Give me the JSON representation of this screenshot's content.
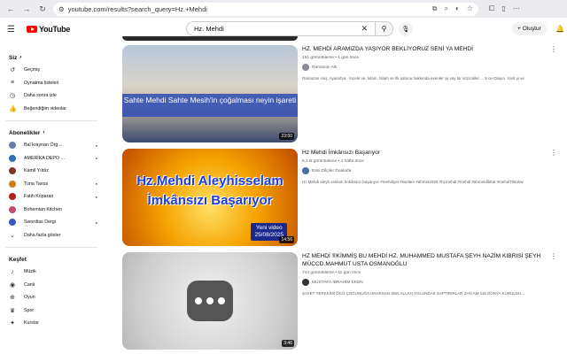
{
  "browser": {
    "url": "youtube.com/results?search_query=Hz.+Mehdi"
  },
  "header": {
    "logo_text": "YouTube",
    "search_value": "Hz. Mehdi",
    "create_label": "Oluştur"
  },
  "sidebar": {
    "you_heading": "Siz",
    "you_items": [
      {
        "label": "Geçmiş",
        "icon": "history-icon"
      },
      {
        "label": "Oynatma listeleri",
        "icon": "playlist-icon"
      },
      {
        "label": "Daha sonra izle",
        "icon": "clock-icon"
      },
      {
        "label": "Beğendiğim videolar",
        "icon": "thumbs-up-icon"
      }
    ],
    "subs_heading": "Abonelikler",
    "subscriptions": [
      {
        "label": "Bal kraynan Örg...",
        "color": "#6b7fa3"
      },
      {
        "label": "AMERİKA DEPO ...",
        "color": "#2f6fba"
      },
      {
        "label": "Kamil Yıldız",
        "color": "#7a3b2a"
      },
      {
        "label": "Tuna Tavus",
        "color": "#d47a1a"
      },
      {
        "label": "Fatih Koparan",
        "color": "#b02020"
      },
      {
        "label": "Bohemian Kitchen",
        "color": "#c24d6a"
      },
      {
        "label": "Swordias Dergi",
        "color": "#3a57c4"
      }
    ],
    "show_more": "Daha fazla göster",
    "explore_heading": "Keşfet",
    "explore_items": [
      {
        "label": "Müzik",
        "icon": "music-icon"
      },
      {
        "label": "Canlı",
        "icon": "live-icon"
      },
      {
        "label": "Oyun",
        "icon": "gamepad-icon"
      },
      {
        "label": "Spor",
        "icon": "trophy-icon"
      },
      {
        "label": "Kurslar",
        "icon": "lightbulb-icon"
      }
    ]
  },
  "results": [
    {
      "title": "HZ. MEHDİ ARAMIZDA YAŞIYOR BEKLİYORUZ SENİ YA MEHDİ",
      "meta": "151 görüntüleme • 1 gün önce",
      "channel": "Ramazan Altı",
      "description": "Ramazan Hoş, Ayasofya · İncele ve, İslam, İslam ve İlk şahına hakkında esenler iyi vay bir sözcükler ... 9 ce Olayın. Yarit yi ve",
      "duration": "23:50",
      "thumb_caption": "Sahte Mehdi Sahte Mesih'in çoğalması neyin işareti"
    },
    {
      "title": "Hz Mehdi İmkânsızı Başarıyor",
      "meta": "6,2 B görüntüleme • 4 hafta önce",
      "channel": "Eski Dîlçiler Dualarla",
      "description": "Hz Mehdi aleyh sselam İmkânsızı başarıyor #mehdiyet #sselam #ahmet2025 #hzmehdi #mehdi #ahmetdîkkat #mehdiTiktokw",
      "duration": "14:56",
      "thumb_line1": "Hz.Mehdi Aleyhisselam",
      "thumb_line2": "İmkânsızı Başarıyor",
      "thumb_badge_1": "Yeni video",
      "thumb_badge_2": "25/08/2025"
    },
    {
      "title": "HZ MEHDİ ®KİMMİŞ BU MEHDİ HZ. MUHAMMED MUSTAFA ŞEYH NAZİM KIBRISİ ŞEYH MÜCCD.MAHMUT USTA OSMANOĞLU",
      "meta": "744 görüntüleme • 11 gün önce",
      "channel": "MUSTAFA İBRAHİM EKEN",
      "description": "ŞAYET YERKKİMİ ÖCÜ ÇOĞUNUĞA UHARSAN SEN ALLAH YOLUNDAK SAPTIRIRLAR ZAN AM 116 DÜNYA KURULDU...",
      "duration": "3:46"
    }
  ]
}
